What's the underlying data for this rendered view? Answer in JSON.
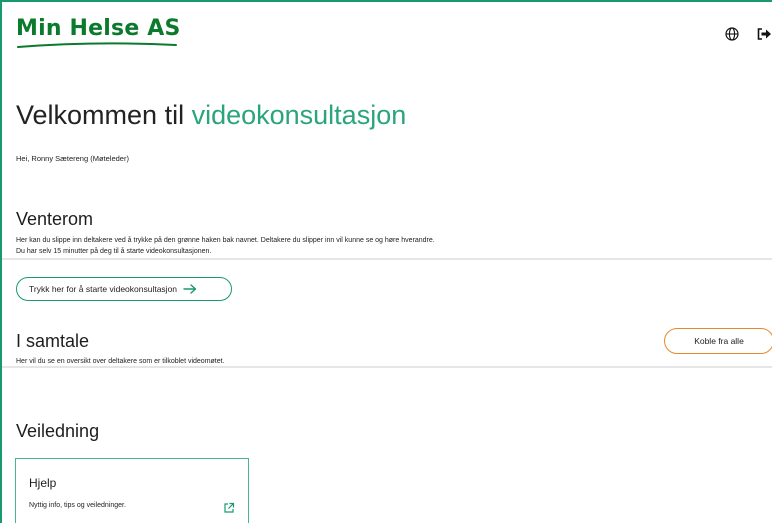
{
  "header": {
    "logo_text": "Min Helse AS",
    "icons": [
      "globe-icon",
      "logout-icon"
    ]
  },
  "welcome": {
    "title_prefix": "Velkommen til ",
    "title_accent": "videokonsultasjon",
    "greeting": "Hei, Ronny Sætereng (Møteleder)"
  },
  "waiting_room": {
    "title": "Venterom",
    "description_line1": "Her kan du slippe inn deltakere ved å trykke på den grønne haken bak navnet. Deltakere du slipper inn vil kunne se og høre hverandre.",
    "description_line2": "Du har selv 15 minutter på deg til å starte videokonsultasjonen.",
    "start_button": "Trykk her for å starte videokonsultasjon"
  },
  "in_call": {
    "title": "I samtale",
    "description": "Her vil du se en oversikt over deltakere som er tilkoblet videomøtet.",
    "disconnect_button": "Koble fra alle"
  },
  "guidance": {
    "title": "Veiledning",
    "card": {
      "title": "Hjelp",
      "description": "Nyttig info, tips og veiledninger."
    }
  },
  "colors": {
    "brand_green": "#0c7a2c",
    "accent_green": "#2aa57a",
    "border_green": "#1a9a6c",
    "warning_orange": "#e58a2b"
  }
}
